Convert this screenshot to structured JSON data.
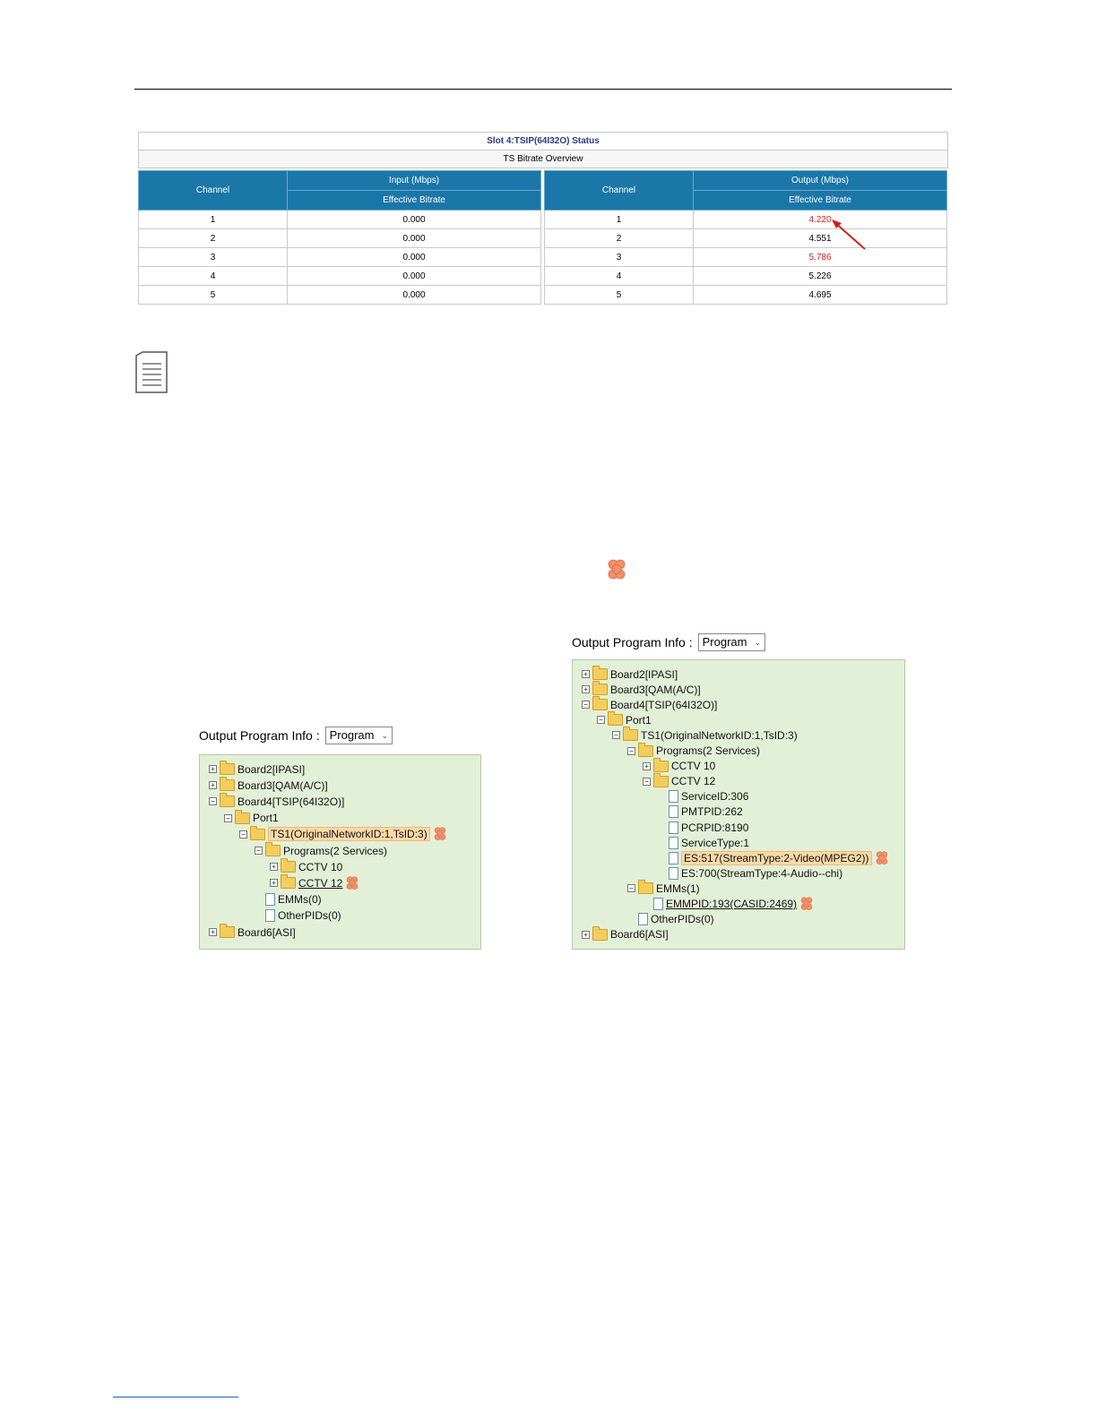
{
  "status_table": {
    "title": "Slot 4:TSIP(64I32O) Status",
    "subtitle": "TS Bitrate Overview",
    "input": {
      "channel_header": "Channel",
      "group_header": "Input (Mbps)",
      "col_header": "Effective Bitrate",
      "rows": [
        {
          "channel": "1",
          "bitrate": "0.000"
        },
        {
          "channel": "2",
          "bitrate": "0.000"
        },
        {
          "channel": "3",
          "bitrate": "0.000"
        },
        {
          "channel": "4",
          "bitrate": "0.000"
        },
        {
          "channel": "5",
          "bitrate": "0.000"
        }
      ]
    },
    "output": {
      "channel_header": "Channel",
      "group_header": "Output (Mbps)",
      "col_header": "Effective Bitrate",
      "rows": [
        {
          "channel": "1",
          "bitrate": "4.220",
          "alert": true
        },
        {
          "channel": "2",
          "bitrate": "4.551",
          "alert": false
        },
        {
          "channel": "3",
          "bitrate": "5.786",
          "alert": true
        },
        {
          "channel": "4",
          "bitrate": "5.226",
          "alert": false
        },
        {
          "channel": "5",
          "bitrate": "4.695",
          "alert": false
        }
      ]
    },
    "alert_color": "#d21f1f",
    "header_color": "#1b77a8"
  },
  "left_panel": {
    "label": "Output Program Info :",
    "select_value": "Program",
    "nodes": [
      {
        "text": "Board2[IPASI]",
        "level": 0,
        "toggle": "+",
        "icon": "folder"
      },
      {
        "text": "Board3[QAM(A/C)]",
        "level": 0,
        "toggle": "+",
        "icon": "folder"
      },
      {
        "text": "Board4[TSIP(64I32O)]",
        "level": 0,
        "toggle": "−",
        "icon": "folder"
      },
      {
        "text": "Port1",
        "level": 1,
        "toggle": "−",
        "icon": "folder"
      },
      {
        "text": "TS1(OriginalNetworkID:1,TsID:3)",
        "level": 2,
        "toggle": "−",
        "icon": "folder",
        "highlight": true,
        "warning": true
      },
      {
        "text": "Programs(2 Services)",
        "level": 3,
        "toggle": "−",
        "icon": "folder"
      },
      {
        "text": "CCTV 10",
        "level": 4,
        "toggle": "+",
        "icon": "folder"
      },
      {
        "text": "CCTV 12",
        "level": 4,
        "toggle": "+",
        "icon": "folder",
        "underline": true,
        "warning": true
      },
      {
        "text": "EMMs(0)",
        "level": 3,
        "toggle": "",
        "icon": "file"
      },
      {
        "text": "OtherPIDs(0)",
        "level": 3,
        "toggle": "",
        "icon": "file"
      },
      {
        "text": "Board6[ASI]",
        "level": 0,
        "toggle": "+",
        "icon": "folder"
      }
    ]
  },
  "right_panel": {
    "label": "Output Program Info :",
    "select_value": "Program",
    "nodes": [
      {
        "text": "Board2[IPASI]",
        "level": 0,
        "toggle": "+",
        "icon": "folder"
      },
      {
        "text": "Board3[QAM(A/C)]",
        "level": 0,
        "toggle": "+",
        "icon": "folder"
      },
      {
        "text": "Board4[TSIP(64I32O)]",
        "level": 0,
        "toggle": "−",
        "icon": "folder"
      },
      {
        "text": "Port1",
        "level": 1,
        "toggle": "−",
        "icon": "folder"
      },
      {
        "text": "TS1(OriginalNetworkID:1,TsID:3)",
        "level": 2,
        "toggle": "−",
        "icon": "folder"
      },
      {
        "text": "Programs(2 Services)",
        "level": 3,
        "toggle": "−",
        "icon": "folder"
      },
      {
        "text": "CCTV 10",
        "level": 4,
        "toggle": "+",
        "icon": "folder"
      },
      {
        "text": "CCTV 12",
        "level": 4,
        "toggle": "−",
        "icon": "folder"
      },
      {
        "text": "ServiceID:306",
        "level": 5,
        "toggle": "",
        "icon": "file"
      },
      {
        "text": "PMTPID:262",
        "level": 5,
        "toggle": "",
        "icon": "file"
      },
      {
        "text": "PCRPID:8190",
        "level": 5,
        "toggle": "",
        "icon": "file"
      },
      {
        "text": "ServiceType:1",
        "level": 5,
        "toggle": "",
        "icon": "file"
      },
      {
        "text": "ES:517(StreamType:2-Video(MPEG2))",
        "level": 5,
        "toggle": "",
        "icon": "file",
        "highlight": true,
        "warning": true
      },
      {
        "text": "ES:700(StreamType:4-Audio--chi)",
        "level": 5,
        "toggle": "",
        "icon": "file"
      },
      {
        "text": "EMMs(1)",
        "level": 3,
        "toggle": "−",
        "icon": "folder"
      },
      {
        "text": "EMMPID:193(CASID:2469)",
        "level": 4,
        "toggle": "",
        "icon": "file",
        "underline": true,
        "warning": true
      },
      {
        "text": "OtherPIDs(0)",
        "level": 3,
        "toggle": "",
        "icon": "file"
      },
      {
        "text": "Board6[ASI]",
        "level": 0,
        "toggle": "+",
        "icon": "folder"
      }
    ]
  }
}
